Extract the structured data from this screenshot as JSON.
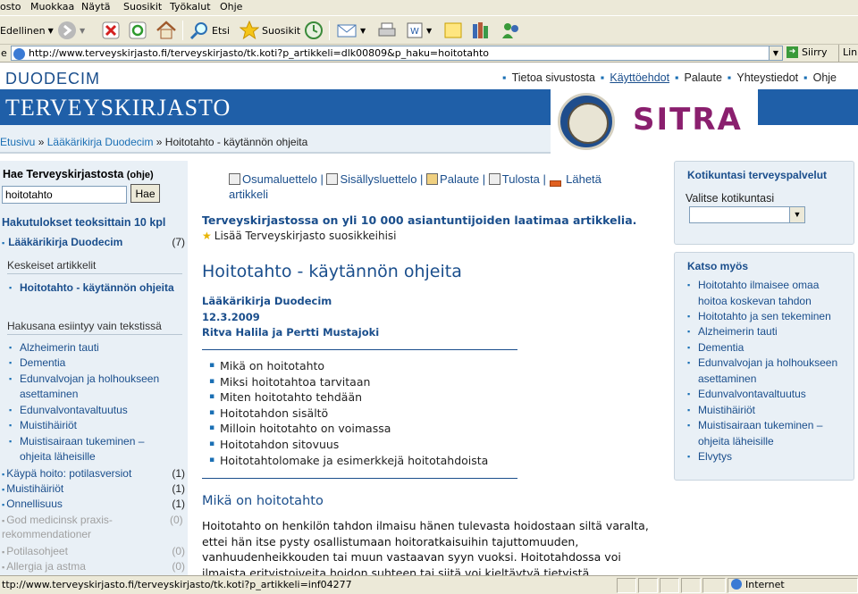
{
  "browser": {
    "menu": [
      "osto",
      "Muokkaa",
      "Näytä",
      "Suosikit",
      "Työkalut",
      "Ohje"
    ],
    "toolbar": {
      "back": "Edellinen",
      "search": "Etsi",
      "favorites": "Suosikit"
    },
    "address_label": "e",
    "address_url": "http://www.terveyskirjasto.fi/terveyskirjasto/tk.koti?p_artikkeli=dlk00809&p_haku=hoitotahto",
    "go_label": "Siirry",
    "links_label": "Lin",
    "status_text": "ttp://www.terveyskirjasto.fi/terveyskirjasto/tk.koti?p_artikkeli=inf04277",
    "zone": "Internet"
  },
  "header": {
    "brand": "DUODECIM",
    "title": "TERVEYSKIRJASTO",
    "partner": "SITRA",
    "nav": [
      "Tietoa sivustosta",
      "Käyttöehdot",
      "Palaute",
      "Yhteystiedot",
      "Ohje"
    ],
    "breadcrumb": [
      "Etusivu",
      "Lääkärikirja Duodecim",
      "Hoitotahto - käytännön ohjeita"
    ]
  },
  "left": {
    "search_heading": "Hae Terveyskirjastosta",
    "search_help": "(ohje)",
    "search_value": "hoitotahto",
    "search_button": "Hae",
    "results_heading": "Hakutulokset teoksittain 10 kpl",
    "primary_book": {
      "label": "Lääkärikirja Duodecim",
      "count": "(7)"
    },
    "key_heading": "Keskeiset artikkelit",
    "key_articles": [
      "Hoitotahto - käytännön ohjeita"
    ],
    "text_heading": "Hakusana esiintyy vain tekstissä",
    "text_articles": [
      "Alzheimerin tauti",
      "Dementia",
      "Edunvalvojan ja holhoukseen asettaminen",
      "Edunvalvontavaltuutus",
      "Muistihäiriöt",
      "Muistisairaan tukeminen – ohjeita läheisille"
    ],
    "other_books": [
      {
        "label": "Käypä hoito: potilasversiot",
        "count": "(1)",
        "muted": false
      },
      {
        "label": "Muistihäiriöt",
        "count": "(1)",
        "muted": false
      },
      {
        "label": "Onnellisuus",
        "count": "(1)",
        "muted": false
      },
      {
        "label": "God medicinsk praxis-rekommendationer",
        "count": "(0)",
        "muted": true
      },
      {
        "label": "Potilasohjeet",
        "count": "(0)",
        "muted": true
      },
      {
        "label": "Allergia ja astma",
        "count": "(0)",
        "muted": true
      }
    ]
  },
  "center": {
    "tools": [
      "Osumaluettelo",
      "Sisällysluettelo",
      "Palaute",
      "Tulosta",
      "Lähetä artikkeli"
    ],
    "promo": "Terveyskirjastossa on yli 10 000 asiantuntijoiden laatimaa artikkelia.",
    "favorite": "Lisää Terveyskirjasto suosikkeihisi",
    "article_title": "Hoitotahto - käytännön ohjeita",
    "book": "Lääkärikirja Duodecim",
    "date": "12.3.2009",
    "authors": "Ritva Halila ja Pertti Mustajoki",
    "toc": [
      "Mikä on hoitotahto",
      "Miksi hoitotahtoa tarvitaan",
      "Miten hoitotahto tehdään",
      "Hoitotahdon sisältö",
      "Milloin hoitotahto on voimassa",
      "Hoitotahdon sitovuus",
      "Hoitotahtolomake ja esimerkkejä hoitotahdoista"
    ],
    "section_heading": "Mikä on hoitotahto",
    "section_text": "Hoitotahto on henkilön tahdon ilmaisu hänen tulevasta hoidostaan siltä varalta, ettei hän itse pysty osallistumaan hoitoratkaisuihin tajuttomuuden, vanhuudenheikkouden tai muun vastaavan syyn vuoksi. Hoitotahdossa voi ilmaista erityistoiveita hoidon suhteen tai siitä voi kieltäytyä tietyistä"
  },
  "right": {
    "muni_heading": "Kotikuntasi terveyspalvelut",
    "muni_label": "Valitse kotikuntasi",
    "muni_value": "",
    "see_heading": "Katso myös",
    "see_links": [
      "Hoitotahto ilmaisee omaa hoitoa koskevan tahdon",
      "Hoitotahto ja sen tekeminen",
      "Alzheimerin tauti",
      "Dementia",
      "Edunvalvojan ja holhoukseen asettaminen",
      "Edunvalvontavaltuutus",
      "Muistihäiriöt",
      "Muistisairaan tukeminen – ohjeita läheisille",
      "Elvytys"
    ]
  }
}
